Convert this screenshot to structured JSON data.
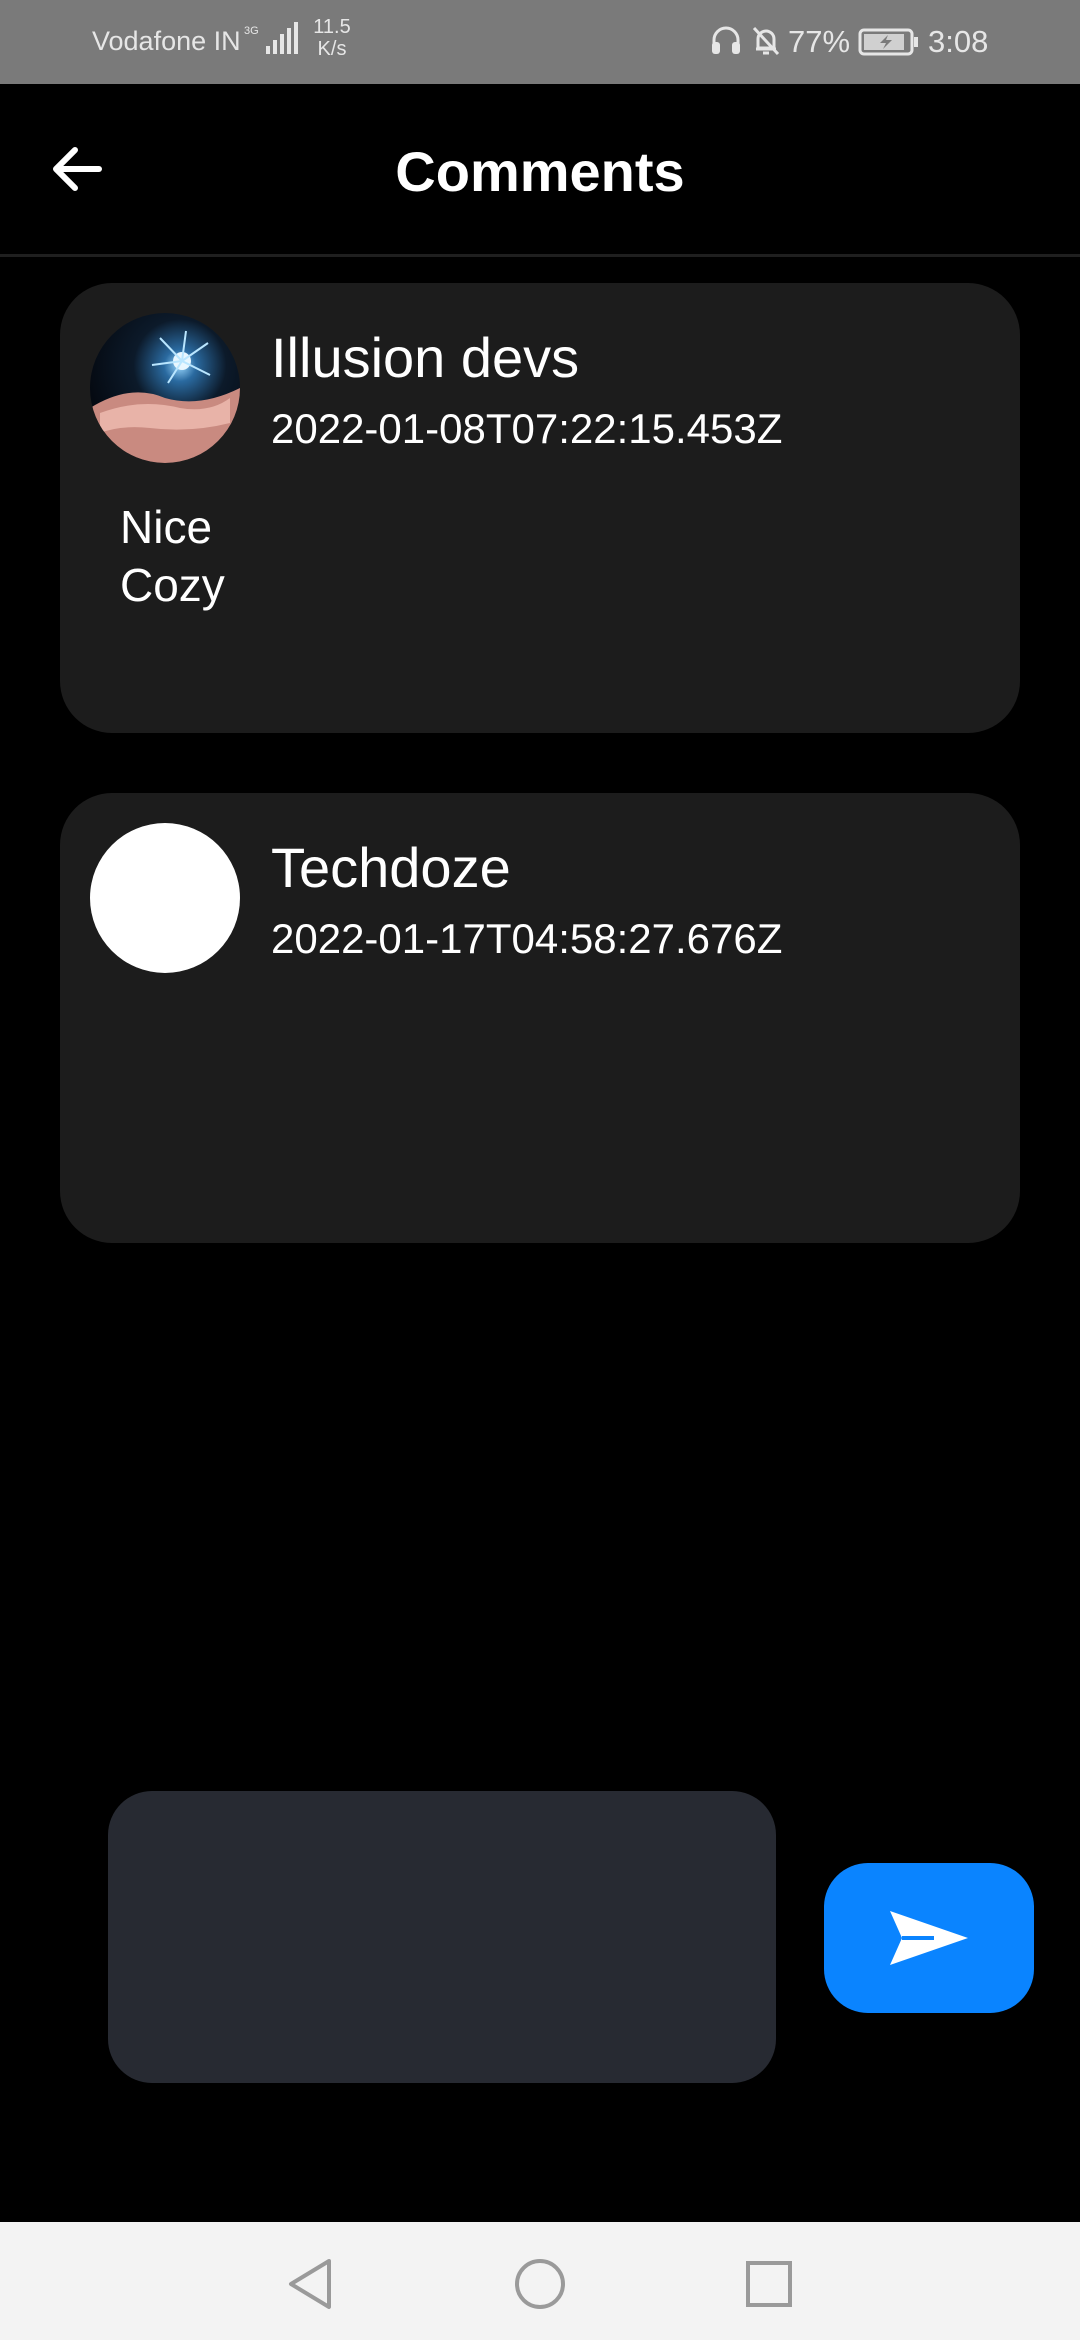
{
  "status_bar": {
    "carrier": "Vodafone IN",
    "network_type": "3G",
    "speed_value": "11.5",
    "speed_unit": "K/s",
    "battery_percent": "77%",
    "time": "3:08",
    "icons": [
      "signal-icon",
      "headset-icon",
      "bell-off-icon",
      "battery-charging-icon"
    ]
  },
  "header": {
    "title": "Comments",
    "back_icon": "arrow-left-icon"
  },
  "comments": [
    {
      "author": "Illusion devs",
      "date": "2022-01-08T07:22:15.453Z",
      "text_lines": [
        "Nice",
        "Cozy"
      ],
      "avatar": "photo"
    },
    {
      "author": "Techdoze",
      "date": "2022-01-17T04:58:27.676Z",
      "text_lines": [
        "",
        ""
      ],
      "avatar": "blank"
    }
  ],
  "composer": {
    "placeholder": "",
    "value": "",
    "send_icon": "send-icon"
  },
  "nav_bar": {
    "icons": [
      "nav-back-icon",
      "nav-home-icon",
      "nav-recents-icon"
    ]
  },
  "colors": {
    "background": "#000000",
    "card": "#1c1c1c",
    "input": "#272a32",
    "accent": "#0a84ff",
    "status_bar": "#7a7a7a",
    "nav_bar": "#f3f3f3"
  }
}
